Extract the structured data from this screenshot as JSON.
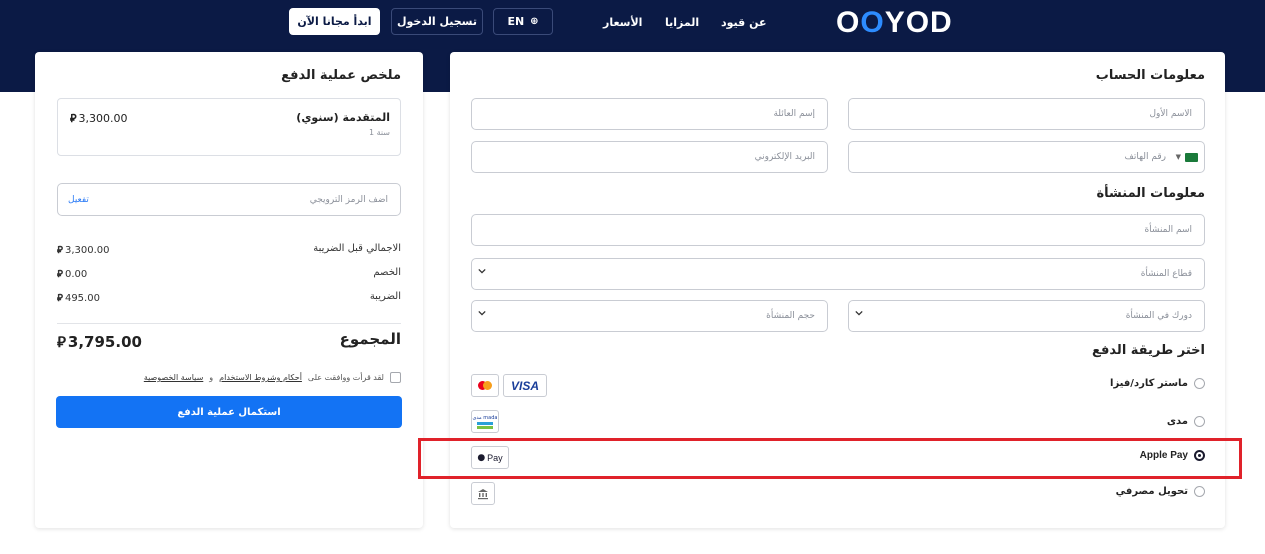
{
  "header": {
    "logo_text_a": "O",
    "logo_dot": "O",
    "logo_text_b": "YOD",
    "nav": [
      "عن قيود",
      "المزايا",
      "الأسعار"
    ],
    "lang_label": "EN",
    "login_label": "تسجيل الدخول",
    "start_label": "ابدأ مجانا الآن"
  },
  "account": {
    "title": "معلومات الحساب",
    "first_name_ph": "الاسم الأول",
    "last_name_ph": "إسم العائلة",
    "phone_ph": "رقم الهاتف",
    "email_ph": "البريد الإلكتروني"
  },
  "org": {
    "title": "معلومات المنشأة",
    "name_ph": "اسم المنشأة",
    "sector_ph": "قطاع المنشأة",
    "role_ph": "دورك في المنشأة",
    "size_ph": "حجم المنشأة"
  },
  "payment": {
    "title": "اختر طريقة الدفع",
    "methods": [
      {
        "label": "ماستر كارد/فيزا",
        "selected": false
      },
      {
        "label": "مدى",
        "selected": false
      },
      {
        "label": "Apple Pay",
        "selected": true
      },
      {
        "label": "تحويل مصرفي",
        "selected": false
      }
    ],
    "visa_text": "VISA",
    "mada_text": "مدى mada",
    "applepay_text": "Pay"
  },
  "summary": {
    "title": "ملخص عملية الدفع",
    "plan_name": "المتقدمة (سنوي)",
    "plan_duration": "1 سنة",
    "plan_price": "3,300.00",
    "coupon_ph": "اضف الرمز الترويجي",
    "coupon_apply": "تفعيل",
    "rows": [
      {
        "label": "الاجمالي قبل الضريبة",
        "value": "3,300.00"
      },
      {
        "label": "الخصم",
        "value": "0.00"
      },
      {
        "label": "الضريبة",
        "value": "495.00"
      }
    ],
    "total_label": "المجموع",
    "total_value": "3,795.00",
    "terms_prefix": "لقد قرأت ووافقت على",
    "terms_link": "أحكام وشروط الاستخدام",
    "terms_and": "و",
    "privacy_link": "سياسة الخصوصية",
    "pay_button": "استكمال عملية الدفع",
    "currency_symbol": "⃁"
  },
  "colors": {
    "header_bg": "#0b1a45",
    "primary": "#1373f4",
    "highlight": "#e0222a"
  }
}
